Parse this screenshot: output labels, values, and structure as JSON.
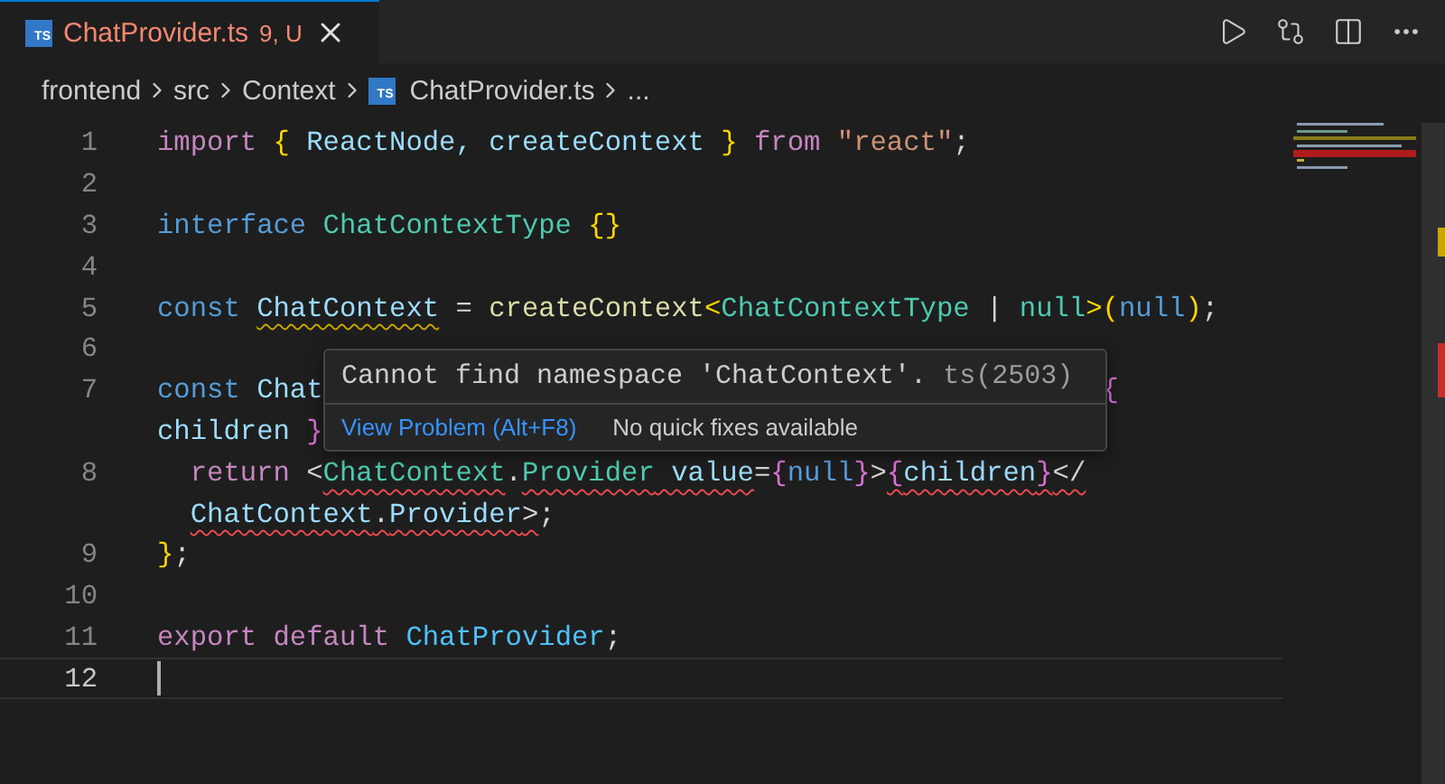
{
  "tab": {
    "icon_label": "TS",
    "title": "ChatProvider.ts",
    "badge": "9, U",
    "selected": true,
    "has_errors": true
  },
  "breadcrumbs": [
    {
      "kind": "folder",
      "label": "frontend"
    },
    {
      "kind": "folder",
      "label": "src"
    },
    {
      "kind": "folder",
      "label": "Context"
    },
    {
      "kind": "file",
      "label": "ChatProvider.ts",
      "icon_label": "TS"
    },
    {
      "kind": "more",
      "label": "..."
    }
  ],
  "lines": [
    {
      "number": "1",
      "current": false,
      "rows": [
        {
          "tokens": [
            {
              "t": "import ",
              "kind": "control"
            },
            {
              "t": "{ ",
              "kind": "bracket"
            },
            {
              "t": "ReactNode, createContext ",
              "kind": "variable"
            },
            {
              "t": "} ",
              "kind": "bracket"
            },
            {
              "t": "from ",
              "kind": "control"
            },
            {
              "t": "\"react\"",
              "kind": "string"
            },
            {
              "t": ";",
              "kind": "plain"
            }
          ]
        }
      ]
    },
    {
      "number": "2",
      "current": false,
      "rows": [
        {
          "tokens": []
        }
      ]
    },
    {
      "number": "3",
      "current": false,
      "rows": [
        {
          "tokens": [
            {
              "t": "interface ",
              "kind": "keyword"
            },
            {
              "t": "ChatContextType ",
              "kind": "type"
            },
            {
              "t": "{}",
              "kind": "bracket"
            }
          ]
        }
      ]
    },
    {
      "number": "4",
      "current": false,
      "rows": [
        {
          "tokens": []
        }
      ]
    },
    {
      "number": "5",
      "current": false,
      "rows": [
        {
          "tokens": [
            {
              "t": "const ",
              "kind": "keyword"
            },
            {
              "t": "ChatContext",
              "kind": "variable",
              "warning": true
            },
            {
              "t": " = ",
              "kind": "plain"
            },
            {
              "t": "createContext",
              "kind": "function"
            },
            {
              "t": "<",
              "kind": "bracket"
            },
            {
              "t": "ChatContextType",
              "kind": "type"
            },
            {
              "t": " | ",
              "kind": "plain"
            },
            {
              "t": "null",
              "kind": "type"
            },
            {
              "t": ">(",
              "kind": "bracket"
            },
            {
              "t": "null",
              "kind": "keyword"
            },
            {
              "t": ")",
              "kind": "bracket"
            },
            {
              "t": ";",
              "kind": "plain"
            }
          ]
        }
      ]
    },
    {
      "number": "6",
      "current": false,
      "rows": [
        {
          "tokens": []
        }
      ]
    },
    {
      "number": "7",
      "current": false,
      "rows": [
        {
          "tokens": [
            {
              "t": "const ",
              "kind": "keyword"
            },
            {
              "t": "Chat",
              "kind": "variable"
            }
          ],
          "tail": [
            {
              "t": "{",
              "kind": "brace"
            }
          ]
        },
        {
          "tokens": [
            {
              "t": "children ",
              "kind": "variable"
            },
            {
              "t": "}",
              "kind": "brace"
            }
          ]
        }
      ],
      "children": [
        {
          "number": "8",
          "current": false,
          "rows": [
            {
              "tokens": [
                {
                  "t": "return ",
                  "kind": "control"
                },
                {
                  "t": "<",
                  "kind": "plain"
                },
                {
                  "t": "ChatContext",
                  "kind": "type",
                  "error": true
                },
                {
                  "t": ".",
                  "kind": "plain"
                },
                {
                  "t": "Provider",
                  "kind": "type",
                  "error": true
                },
                {
                  "t": " value",
                  "kind": "variable",
                  "error": true
                },
                {
                  "t": "=",
                  "kind": "plain"
                },
                {
                  "t": "{",
                  "kind": "brace"
                },
                {
                  "t": "null",
                  "kind": "keyword"
                },
                {
                  "t": "}",
                  "kind": "brace"
                },
                {
                  "t": ">",
                  "kind": "plain"
                },
                {
                  "t": "{",
                  "kind": "brace",
                  "error": true
                },
                {
                  "t": "children",
                  "kind": "variable",
                  "error": true
                },
                {
                  "t": "}",
                  "kind": "brace",
                  "error": true
                },
                {
                  "t": "</",
                  "kind": "plain",
                  "error": true
                }
              ]
            },
            {
              "tokens": [
                {
                  "t": "ChatContext",
                  "kind": "variable",
                  "error": true
                },
                {
                  "t": ".",
                  "kind": "plain",
                  "error": true
                },
                {
                  "t": "Provider",
                  "kind": "variable",
                  "error": true
                },
                {
                  "t": ">",
                  "kind": "plain",
                  "error": true
                },
                {
                  "t": ";",
                  "kind": "plain"
                }
              ]
            }
          ]
        }
      ]
    },
    {
      "number": "9",
      "current": false,
      "rows": [
        {
          "tokens": [
            {
              "t": "}",
              "kind": "bracket"
            },
            {
              "t": ";",
              "kind": "plain"
            }
          ]
        }
      ]
    },
    {
      "number": "10",
      "current": false,
      "rows": [
        {
          "tokens": []
        }
      ]
    },
    {
      "number": "11",
      "current": false,
      "rows": [
        {
          "tokens": [
            {
              "t": "export default ",
              "kind": "control"
            },
            {
              "t": "ChatProvider",
              "kind": "name"
            },
            {
              "t": ";",
              "kind": "plain"
            }
          ]
        }
      ]
    },
    {
      "number": "12",
      "current": true,
      "rows": [
        {
          "tokens": []
        }
      ]
    }
  ],
  "hover": {
    "message": "Cannot find namespace 'ChatContext'.",
    "code": "ts(2503)",
    "action": "View Problem (Alt+F8)",
    "note": "No quick fixes available"
  }
}
